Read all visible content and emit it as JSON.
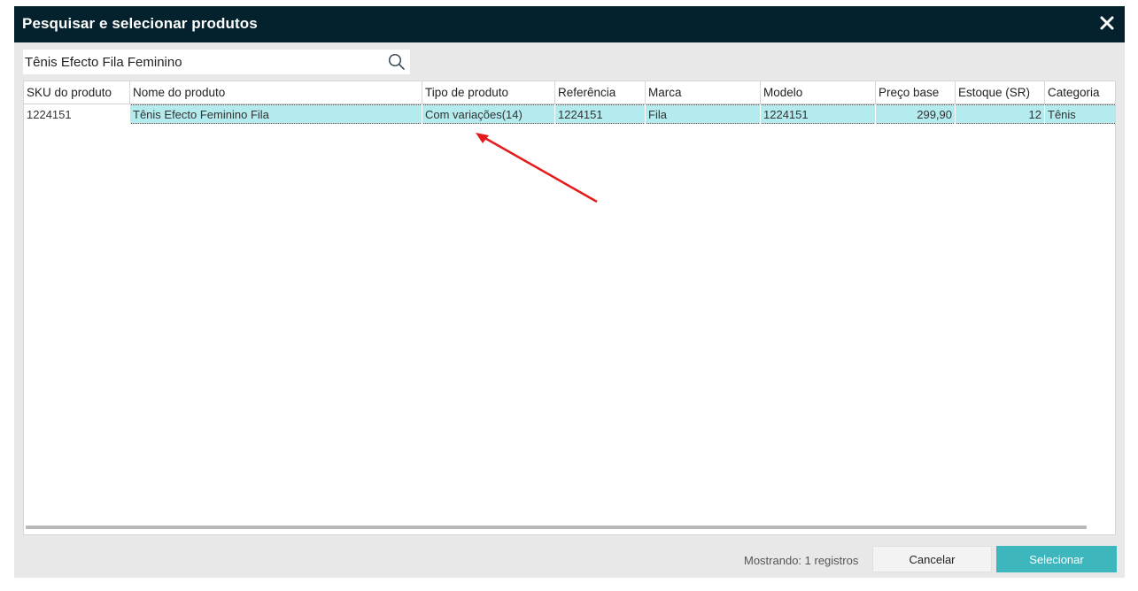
{
  "dialog": {
    "title": "Pesquisar e selecionar produtos",
    "close_icon": "close-icon"
  },
  "search": {
    "value": "Tênis Efecto Fila Feminino",
    "icon": "search-icon"
  },
  "table": {
    "columns": [
      "SKU do produto",
      "Nome do produto",
      "Tipo de produto",
      "Referência",
      "Marca",
      "Modelo",
      "Preço base",
      "Estoque (SR)",
      "Categoria"
    ],
    "rows": [
      {
        "sku": "1224151",
        "name": "Tênis Efecto Feminino Fila",
        "type": "Com variações(14)",
        "reference": "1224151",
        "brand": "Fila",
        "model": "1224151",
        "price": "299,90",
        "stock": "12",
        "category": "Tênis"
      }
    ],
    "selected_row_color": "#b3ebee"
  },
  "footer": {
    "status": "Mostrando: 1 registros",
    "cancel_label": "Cancelar",
    "select_label": "Selecionar"
  },
  "colors": {
    "titlebar": "#03222d",
    "accent": "#3db7bd",
    "annotation_arrow": "#e31b1b"
  }
}
